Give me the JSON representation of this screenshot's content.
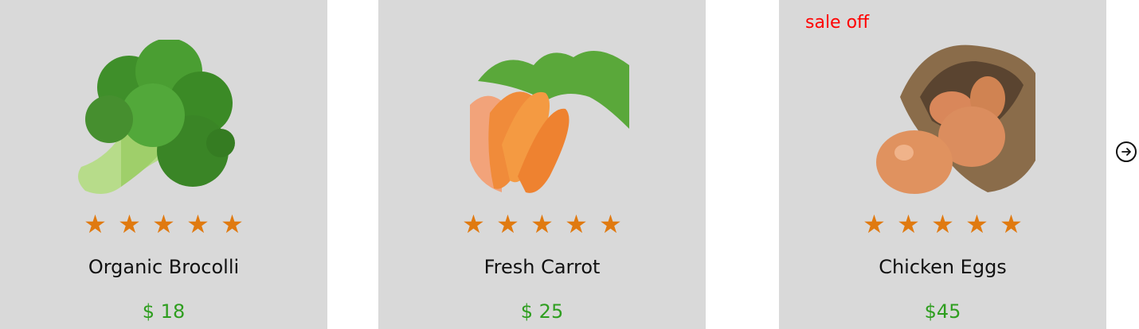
{
  "products": [
    {
      "name": "Organic Brocolli",
      "price": "$ 18",
      "rating": 5,
      "sale_label": ""
    },
    {
      "name": "Fresh Carrot",
      "price": "$ 25",
      "rating": 5,
      "sale_label": ""
    },
    {
      "name": "Chicken Eggs",
      "price": "$45",
      "rating": 5,
      "sale_label": "sale off"
    }
  ],
  "colors": {
    "card_bg": "#d9d9d9",
    "star": "#e07a10",
    "price": "#2e9e1f",
    "sale": "#ff0000"
  },
  "icons": {
    "next": "arrow-right-circle-icon",
    "star": "star-icon"
  }
}
